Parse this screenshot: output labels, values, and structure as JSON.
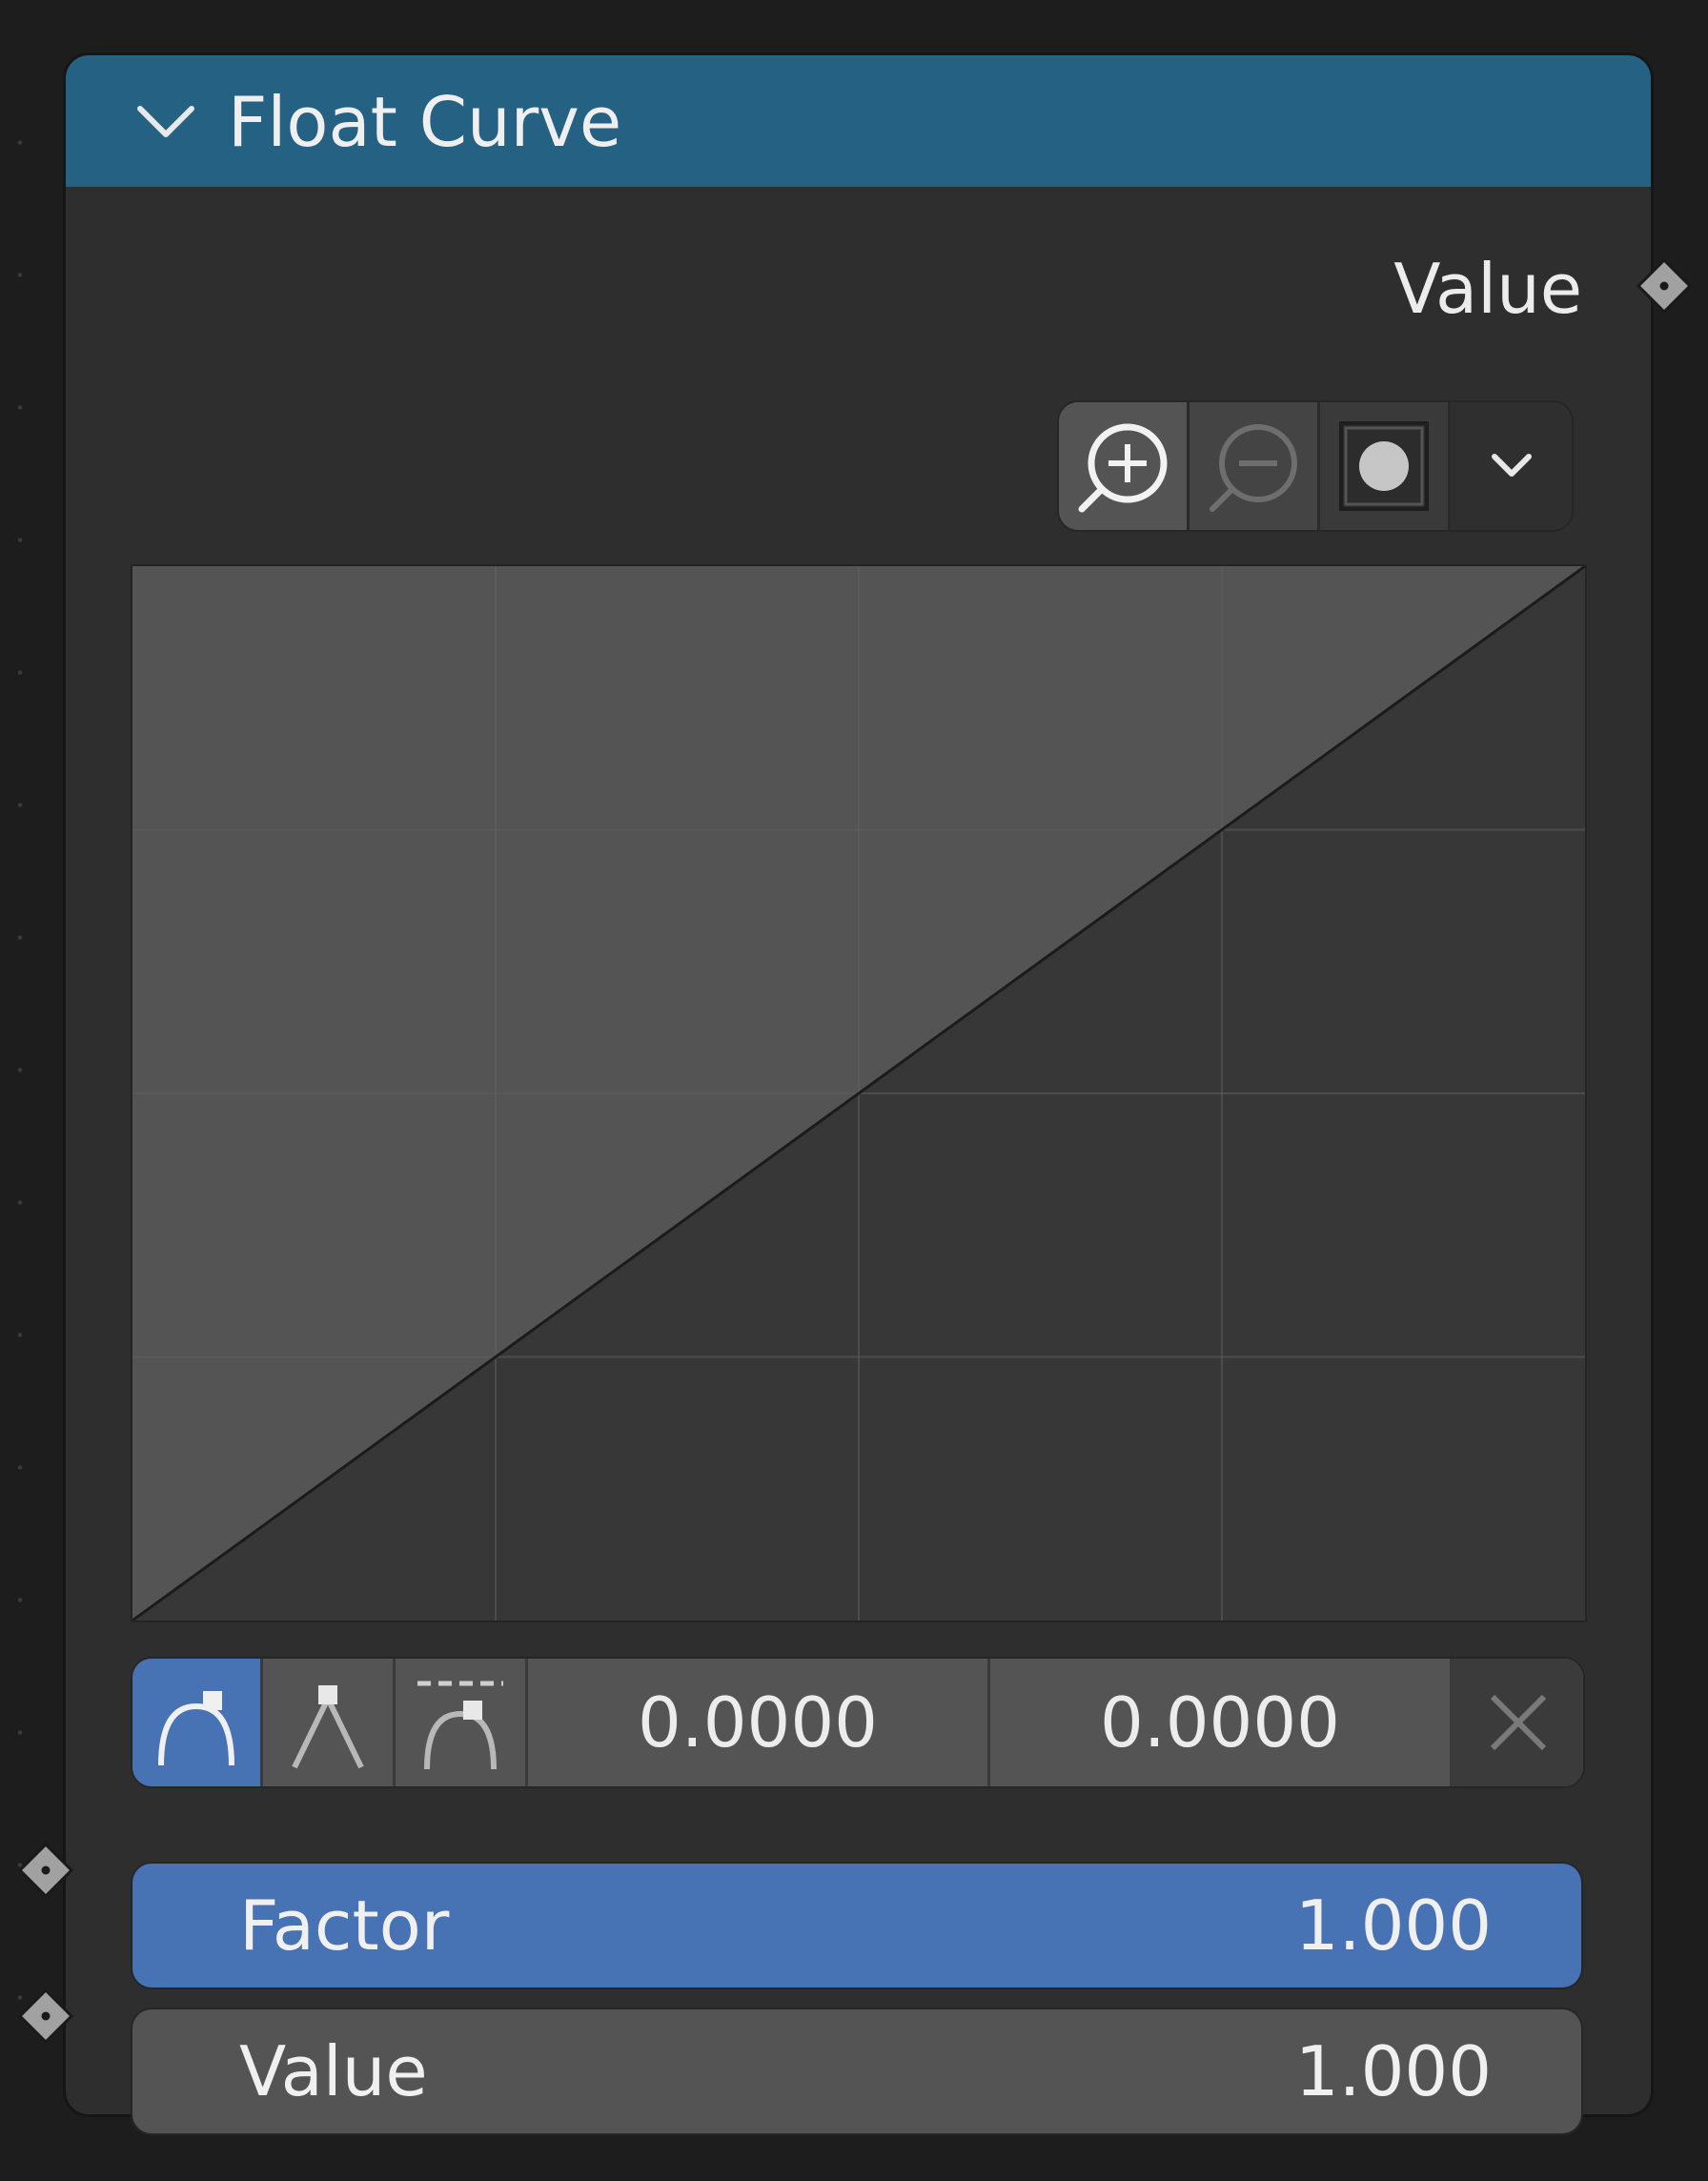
{
  "node": {
    "title": "Float Curve",
    "header_color": "#246183",
    "output_socket_label": "Value"
  },
  "toolbar": {
    "icons": [
      "zoom-in-icon",
      "zoom-out-icon",
      "clip-icon",
      "chevron-down-icon"
    ]
  },
  "curve": {
    "points": [
      [
        0.0,
        0.0
      ],
      [
        1.0,
        1.0
      ]
    ],
    "grid_divisions": 4,
    "line_type": "linear"
  },
  "point_bar": {
    "handle_icons": [
      "auto-handle-icon",
      "vector-handle-icon",
      "auto-clamped-handle-icon"
    ],
    "x_value": "0.0000",
    "y_value": "0.0000",
    "delete_icon": "close-icon"
  },
  "inputs": {
    "factor_label": "Factor",
    "factor_value": "1.000",
    "value_label": "Value",
    "value_value": "1.000"
  },
  "colors": {
    "accent": "#4772b3",
    "node_bg": "#2e2e2e",
    "socket": "#a1a1a1"
  }
}
